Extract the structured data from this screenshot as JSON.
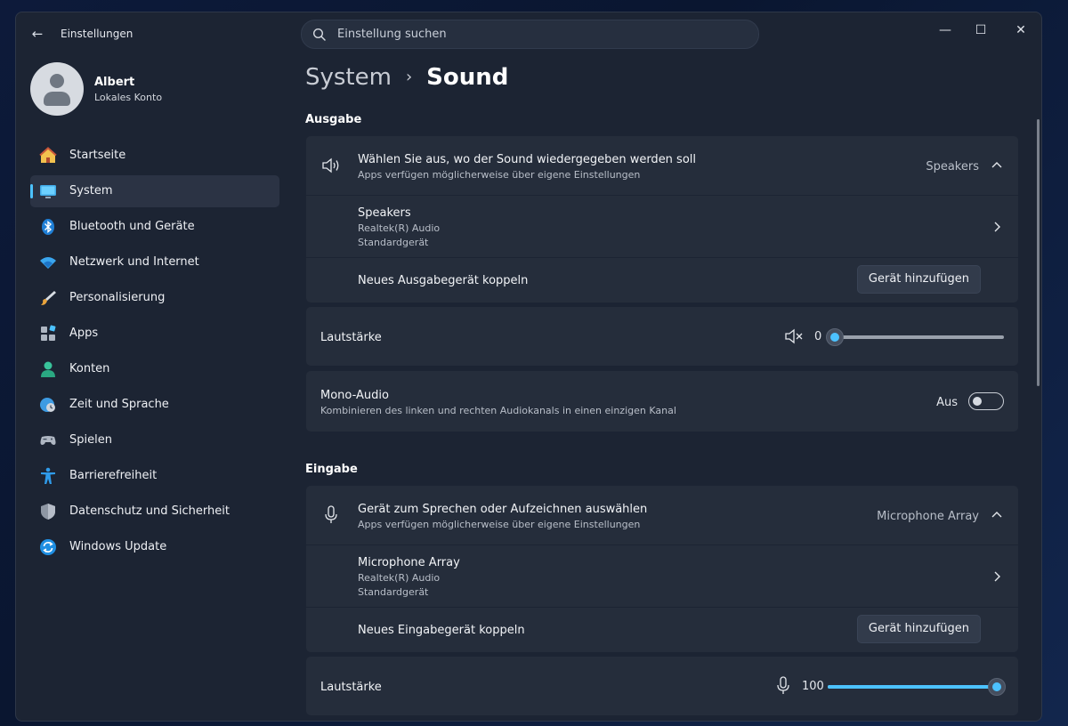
{
  "window": {
    "title": "Einstellungen",
    "controls": {
      "minimize": "—",
      "maximize": "☐",
      "close": "✕"
    }
  },
  "search": {
    "placeholder": "Einstellung suchen"
  },
  "profile": {
    "name": "Albert",
    "account": "Lokales Konto"
  },
  "sidebar": {
    "items": [
      {
        "label": "Startseite",
        "icon": "home-icon",
        "active": false
      },
      {
        "label": "System",
        "icon": "monitor-icon",
        "active": true
      },
      {
        "label": "Bluetooth und Geräte",
        "icon": "bluetooth-icon",
        "active": false
      },
      {
        "label": "Netzwerk und Internet",
        "icon": "wifi-icon",
        "active": false
      },
      {
        "label": "Personalisierung",
        "icon": "brush-icon",
        "active": false
      },
      {
        "label": "Apps",
        "icon": "apps-icon",
        "active": false
      },
      {
        "label": "Konten",
        "icon": "person-icon",
        "active": false
      },
      {
        "label": "Zeit und Sprache",
        "icon": "globe-clock-icon",
        "active": false
      },
      {
        "label": "Spielen",
        "icon": "gamepad-icon",
        "active": false
      },
      {
        "label": "Barrierefreiheit",
        "icon": "accessibility-icon",
        "active": false
      },
      {
        "label": "Datenschutz und Sicherheit",
        "icon": "shield-icon",
        "active": false
      },
      {
        "label": "Windows Update",
        "icon": "update-icon",
        "active": false
      }
    ]
  },
  "breadcrumb": {
    "parent": "System",
    "separator": "›",
    "current": "Sound"
  },
  "output": {
    "section_title": "Ausgabe",
    "device_select": {
      "title": "Wählen Sie aus, wo der Sound wiedergegeben werden soll",
      "subtitle": "Apps verfügen möglicherweise über eigene Einstellungen",
      "value": "Speakers"
    },
    "device": {
      "name": "Speakers",
      "driver": "Realtek(R) Audio",
      "status": "Standardgerät"
    },
    "pair": {
      "label": "Neues Ausgabegerät koppeln",
      "button": "Gerät hinzufügen"
    },
    "volume": {
      "label": "Lautstärke",
      "value": "0",
      "level": 0
    },
    "mono": {
      "title": "Mono-Audio",
      "subtitle": "Kombinieren des linken und rechten Audiokanals in einen einzigen Kanal",
      "state": "Aus"
    }
  },
  "input": {
    "section_title": "Eingabe",
    "device_select": {
      "title": "Gerät zum Sprechen oder Aufzeichnen auswählen",
      "subtitle": "Apps verfügen möglicherweise über eigene Einstellungen",
      "value": "Microphone Array"
    },
    "device": {
      "name": "Microphone Array",
      "driver": "Realtek(R) Audio",
      "status": "Standardgerät"
    },
    "pair": {
      "label": "Neues Eingabegerät koppeln",
      "button": "Gerät hinzufügen"
    },
    "volume": {
      "label": "Lautstärke",
      "value": "100",
      "level": 1
    }
  },
  "colors": {
    "accent": "#4cc2ff",
    "background": "#1c2433",
    "card": "#252d3b"
  }
}
